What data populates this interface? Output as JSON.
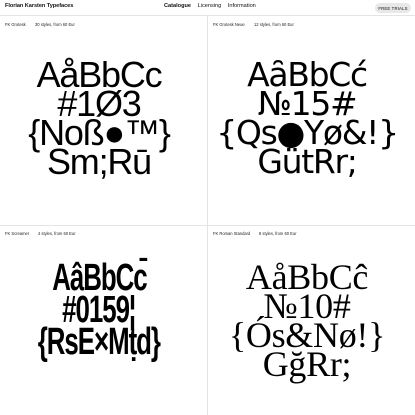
{
  "header": {
    "brand": "Florian Karsten Typefaces",
    "nav": {
      "catalogue": "Catalogue",
      "licensing": "Licensing",
      "information": "Information"
    },
    "cta": "FREE TRIALS"
  },
  "fonts": [
    {
      "name": "FK Grotesk",
      "styles": "30 styles, from 60 Eur",
      "lines": [
        "AåBbCc",
        "#1Ø3",
        "{Nоß●™}",
        "Sm;Rū"
      ]
    },
    {
      "name": "FK Grotesk Neue",
      "styles": "12 styles, from 60 Eur",
      "lines": [
        "AȃBbCć",
        "№15#",
        "{Qs●Yø&!}",
        "GütRr;"
      ]
    },
    {
      "name": "FK Screamer",
      "styles": "4 styles, from 60 Eur",
      "lines": [
        "AâBbCc̄",
        "#0159¦",
        "{RsE×Mṭd}"
      ]
    },
    {
      "name": "FK Roman Standard",
      "styles": "8 styles, from 60 Eur",
      "lines": [
        "AåBbCĉ",
        "№10#",
        "{Ós&Nø!}",
        "GğRr;"
      ]
    }
  ]
}
